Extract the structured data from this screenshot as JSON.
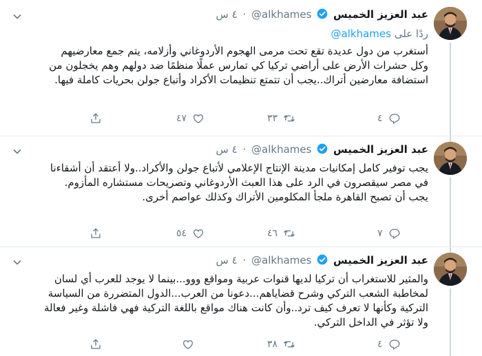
{
  "colors": {
    "accent": "#1da1f2",
    "muted": "#657786",
    "text": "#14171a",
    "line": "#ccd6dd"
  },
  "icons": [
    "chevron-down-icon",
    "verified-badge-icon",
    "reply-icon",
    "retweet-icon",
    "like-icon",
    "share-icon"
  ],
  "tweets": [
    {
      "author": {
        "name": "عبد العزيز الخميس",
        "handle": "@alkhames"
      },
      "time": "٤ س",
      "reply_to": {
        "prefix": "ردًا على",
        "mention": "@alkhames"
      },
      "text": [
        "أستغرب من دول عديدة تقع تحت مرمى الهجوم الأردوغاني وأزلامه، يتم جمع معارضيهم وكل حشرات الأرض على أراضي تركيا كي تمارس عملًا منظمًا ضد دولهم وهم يخجلون من استضافة معارضين أتراك..يجب أن تتمتع تنظيمات الأكراد وأتباع جولن بحريات كاملة فيها."
      ],
      "stats": {
        "replies": "٤",
        "retweets": "٣٣",
        "likes": "٤٧"
      }
    },
    {
      "author": {
        "name": "عبد العزيز الخميس",
        "handle": "@alkhames"
      },
      "time": "٤ س",
      "text": [
        "يجب توفير كامل إمكانيات مدينة الإنتاج الإعلامي لأتباع جولن والأكراد..ولا أعتقد أن أشقاءنا في مصر سيقصرون في الرد على هذا العبث الأردوغاني وتصريحات مستشاره المأزوم.",
        "يجب أن تصبح القاهرة ملجأ المكلومين الأتراك وكذلك عواصم أخرى."
      ],
      "stats": {
        "replies": "٧",
        "retweets": "٤٦",
        "likes": "٥٤"
      }
    },
    {
      "author": {
        "name": "عبد العزيز الخميس",
        "handle": "@alkhames"
      },
      "time": "٤ س",
      "text": [
        "والمثير للاستغراب أن تركيا لديها قنوات عربية ومواقع ووو...بينما لا يوجد للعرب أي لسان لمخاطبة الشعب التركي وشرح قضاياهم...دعونا من العرب...الدول المتضررة من السياسة التركية وكأنها لا تعرف كيف ترد..وأن كانت هناك مواقع باللغة التركية فهي فاشلة وغير فعالة ولا تؤثر في الداخل التركي."
      ],
      "stats": {
        "replies": "٤",
        "retweets": "٣٨",
        "likes": ""
      }
    }
  ]
}
